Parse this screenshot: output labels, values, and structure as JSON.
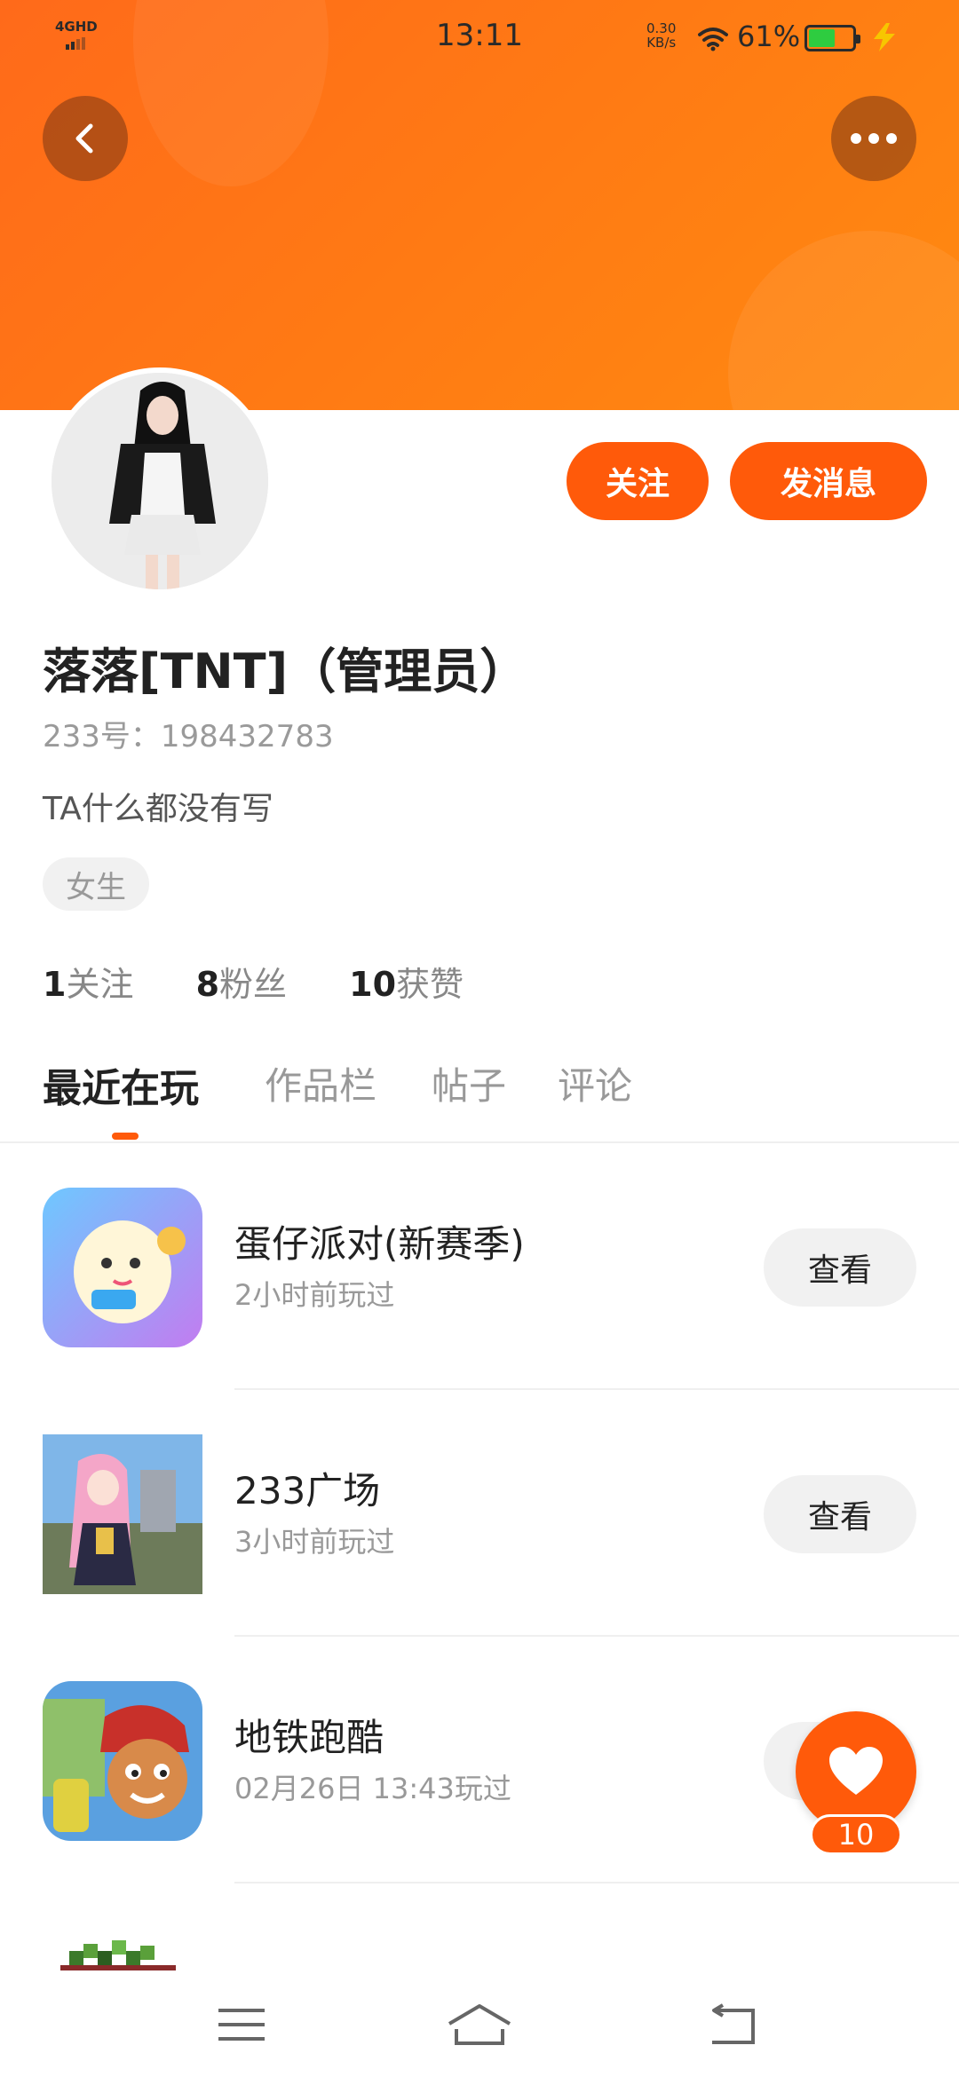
{
  "status_bar": {
    "network": "4GHD",
    "time": "13:11",
    "speed_value": "0.30",
    "speed_unit": "KB/s",
    "battery_percent": "61%",
    "battery_level": 0.61
  },
  "profile": {
    "name": "落落[TNT]（管理员）",
    "uid": "233号：198432783",
    "bio": "TA什么都没有写",
    "gender_tag": "女生",
    "follow_label": "关注",
    "message_label": "发消息",
    "stats": [
      {
        "value": "1",
        "label": "关注"
      },
      {
        "value": "8",
        "label": "粉丝"
      },
      {
        "value": "10",
        "label": "获赞"
      }
    ]
  },
  "tabs": [
    {
      "label": "最近在玩",
      "active": true
    },
    {
      "label": "作品栏",
      "active": false
    },
    {
      "label": "帖子",
      "active": false
    },
    {
      "label": "评论",
      "active": false
    }
  ],
  "games": [
    {
      "title": "蛋仔派对(新赛季)",
      "time": "2小时前玩过",
      "action": "查看"
    },
    {
      "title": "233广场",
      "time": "3小时前玩过",
      "action": "查看"
    },
    {
      "title": "地铁跑酷",
      "time": "02月26日 13:43玩过",
      "action": "查看"
    }
  ],
  "like": {
    "count": "10"
  },
  "colors": {
    "accent": "#ff5a0a",
    "banner": "#ff7a14"
  }
}
